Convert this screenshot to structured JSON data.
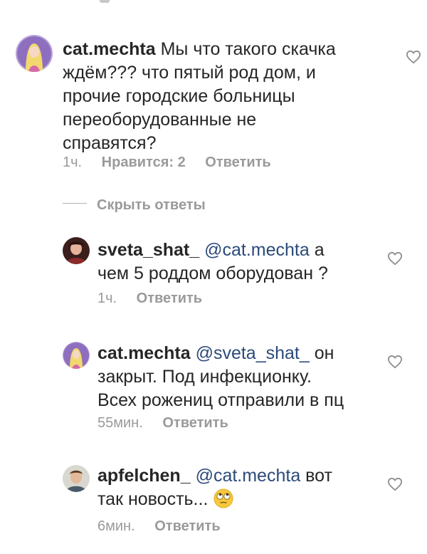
{
  "comments": [
    {
      "username": "cat.mechta",
      "text_lines": [
        "Мы что такого скачка",
        "ждём??? что пятый род дом, и",
        "прочие городские больницы",
        "переоборудованные не",
        "справятся?"
      ],
      "time": "1ч.",
      "likes": "Нравится: 2",
      "reply": "Ответить"
    }
  ],
  "hide_replies": "Скрыть ответы",
  "replies": [
    {
      "username": "sveta_shat_",
      "mention": "@cat.mechta",
      "text_after_mention": " а",
      "text_line2": "чем 5 роддом  оборудован ?",
      "time": "1ч.",
      "reply": "Ответить"
    },
    {
      "username": "cat.mechta",
      "mention": "@sveta_shat_",
      "text_after_mention": " он",
      "text_line2": "закрыт. Под инфекционку.",
      "text_line3": "Всех рожениц отправили в пц",
      "time": "55мин.",
      "reply": "Ответить"
    },
    {
      "username": "apfelchen_",
      "mention": "@cat.mechta",
      "text_after_mention": " вот",
      "text_line2": "так новость...",
      "time": "6мин.",
      "reply": "Ответить",
      "emoji": "face-with-rolling-eyes"
    }
  ],
  "icons": {
    "like": "heart-outline-icon"
  },
  "colors": {
    "text": "#262626",
    "secondary": "#9a9a9a",
    "mention": "#2b4a7a"
  }
}
